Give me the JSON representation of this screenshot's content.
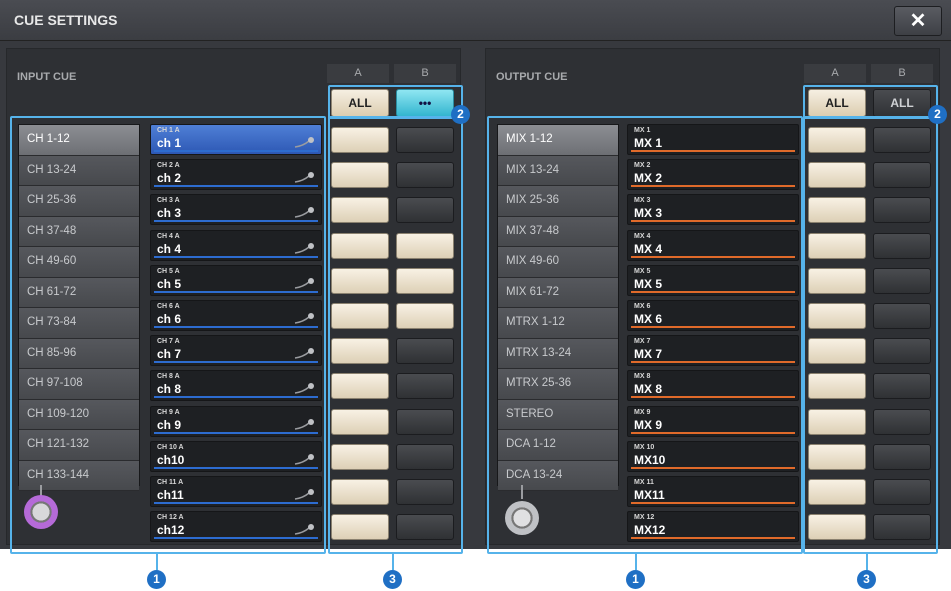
{
  "window": {
    "title": "CUE SETTINGS",
    "close_icon": "close-icon"
  },
  "input": {
    "section_label": "INPUT CUE",
    "col_a": "A",
    "col_b": "B",
    "all_a": "ALL",
    "all_b": "•••",
    "banks": [
      "CH 1-12",
      "CH 13-24",
      "CH 25-36",
      "CH 37-48",
      "CH 49-60",
      "CH 61-72",
      "CH 73-84",
      "CH 85-96",
      "CH 97-108",
      "CH 109-120",
      "CH 121-132",
      "CH 133-144"
    ],
    "channels": [
      {
        "top": "CH 1 A",
        "name": "ch 1"
      },
      {
        "top": "CH 2 A",
        "name": "ch 2"
      },
      {
        "top": "CH 3 A",
        "name": "ch 3"
      },
      {
        "top": "CH 4 A",
        "name": "ch 4"
      },
      {
        "top": "CH 5 A",
        "name": "ch 5"
      },
      {
        "top": "CH 6 A",
        "name": "ch 6"
      },
      {
        "top": "CH 7 A",
        "name": "ch 7"
      },
      {
        "top": "CH 8 A",
        "name": "ch 8"
      },
      {
        "top": "CH 9 A",
        "name": "ch 9"
      },
      {
        "top": "CH 10 A",
        "name": "ch10"
      },
      {
        "top": "CH 11 A",
        "name": "ch11"
      },
      {
        "top": "CH 12 A",
        "name": "ch12"
      }
    ],
    "cue_b_on": [
      false,
      false,
      false,
      true,
      true,
      true,
      false,
      false,
      false,
      false,
      false,
      false
    ],
    "accent": "#2d6cd0"
  },
  "output": {
    "section_label": "OUTPUT CUE",
    "col_a": "A",
    "col_b": "B",
    "all_a": "ALL",
    "all_b": "ALL",
    "banks": [
      "MIX 1-12",
      "MIX 13-24",
      "MIX 25-36",
      "MIX 37-48",
      "MIX 49-60",
      "MIX 61-72",
      "MTRX 1-12",
      "MTRX 13-24",
      "MTRX 25-36",
      "STEREO",
      "DCA 1-12",
      "DCA 13-24"
    ],
    "channels": [
      {
        "top": "MX 1",
        "name": "MX 1"
      },
      {
        "top": "MX 2",
        "name": "MX 2"
      },
      {
        "top": "MX 3",
        "name": "MX 3"
      },
      {
        "top": "MX 4",
        "name": "MX 4"
      },
      {
        "top": "MX 5",
        "name": "MX 5"
      },
      {
        "top": "MX 6",
        "name": "MX 6"
      },
      {
        "top": "MX 7",
        "name": "MX 7"
      },
      {
        "top": "MX 8",
        "name": "MX 8"
      },
      {
        "top": "MX 9",
        "name": "MX 9"
      },
      {
        "top": "MX 10",
        "name": "MX10"
      },
      {
        "top": "MX 11",
        "name": "MX11"
      },
      {
        "top": "MX 12",
        "name": "MX12"
      }
    ],
    "cue_b_on": [
      false,
      false,
      false,
      false,
      false,
      false,
      false,
      false,
      false,
      false,
      false,
      false
    ],
    "accent": "#e06a2a"
  },
  "callouts": {
    "one": "1",
    "two": "2",
    "three": "3"
  },
  "highlight_color": "#56b3ea"
}
